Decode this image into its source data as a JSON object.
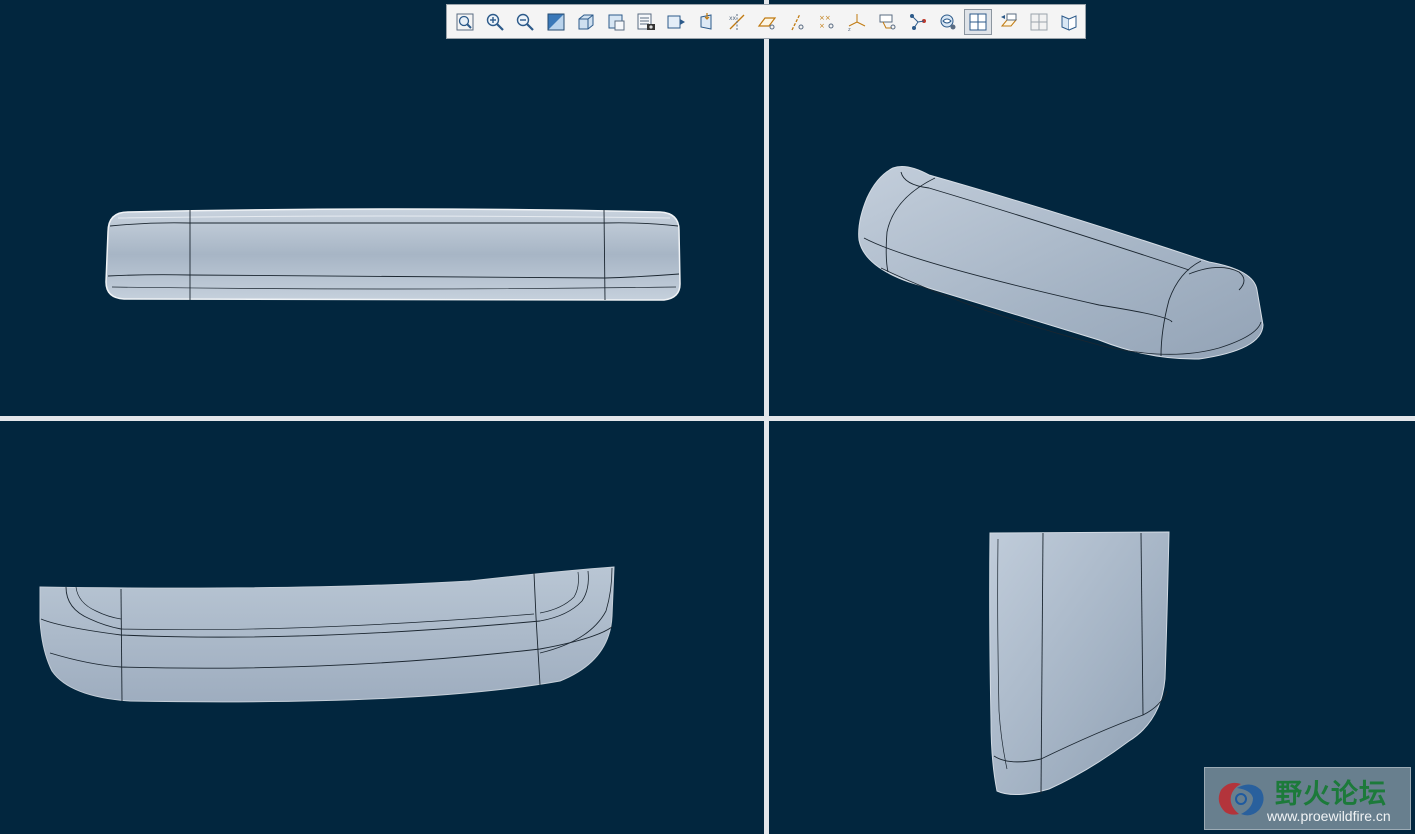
{
  "toolbar": {
    "buttons": [
      {
        "icon": "refit-icon"
      },
      {
        "icon": "zoom-in-icon"
      },
      {
        "icon": "zoom-out-icon"
      },
      {
        "icon": "repaint-icon"
      },
      {
        "icon": "display-style-icon"
      },
      {
        "icon": "saved-orientations-icon"
      },
      {
        "icon": "view-manager-icon"
      },
      {
        "icon": "appearance-icon"
      },
      {
        "icon": "perspective-icon"
      },
      {
        "icon": "datum-display-icon"
      },
      {
        "icon": "plane-display-icon"
      },
      {
        "icon": "axis-display-icon"
      },
      {
        "icon": "point-display-icon"
      },
      {
        "icon": "csys-display-icon"
      },
      {
        "icon": "annotation-display-icon"
      },
      {
        "icon": "spin-center-icon"
      },
      {
        "icon": "view-visibility-icon"
      },
      {
        "icon": "multi-viewport-icon",
        "active": true
      },
      {
        "icon": "flip-view-icon"
      },
      {
        "icon": "grid-view-icon"
      },
      {
        "icon": "section-view-icon"
      }
    ]
  },
  "colors": {
    "background": "#02263e",
    "model_fill": "#a6b4c4",
    "divider": "#e3e6ea"
  },
  "watermark": {
    "title": "野火论坛",
    "url": "www.proewildfire.cn"
  }
}
